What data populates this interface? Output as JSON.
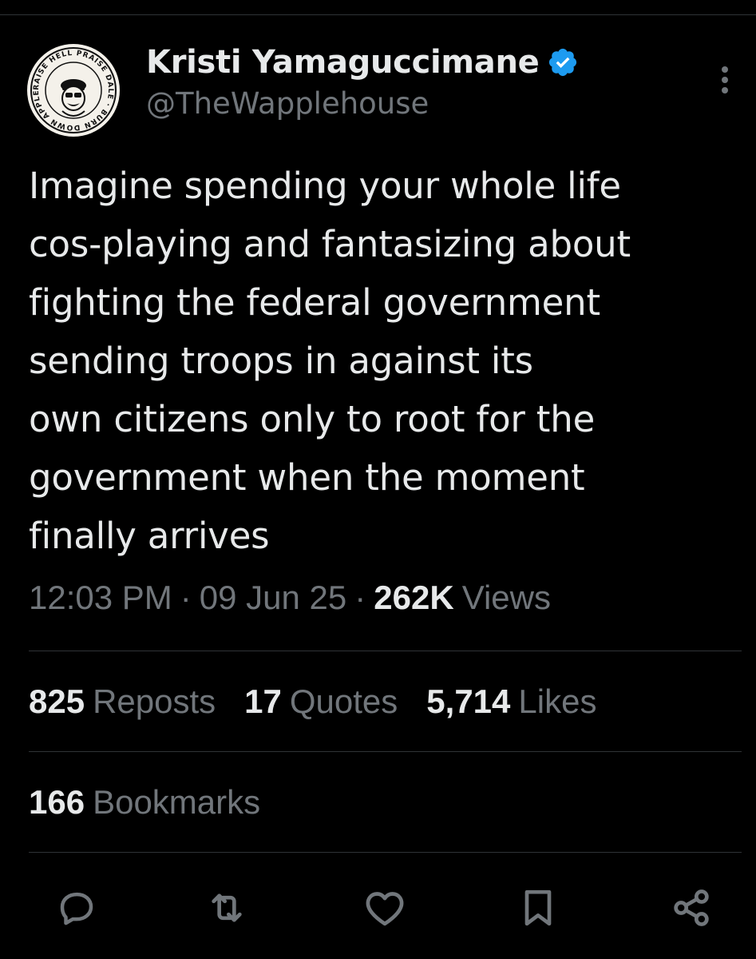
{
  "author": {
    "display_name": "Kristi Yamaguccimane",
    "handle": "@TheWapplehouse",
    "verified": true,
    "avatar_text": "RAISE HELL PRAISE DALE BURN DOWN APPLEBEE'S"
  },
  "tweet": {
    "text": "Imagine spending your whole life\ncos-playing and fantasizing about\nfighting the federal government\nsending troops in against its\nown citizens only to root for the\ngovernment when the moment\nfinally arrives",
    "time": "12:03 PM",
    "date": "09 Jun 25",
    "views_count": "262K",
    "views_label": "Views",
    "separator": "·"
  },
  "stats": {
    "reposts": {
      "count": "825",
      "label": "Reposts"
    },
    "quotes": {
      "count": "17",
      "label": "Quotes"
    },
    "likes": {
      "count": "5,714",
      "label": "Likes"
    },
    "bookmarks": {
      "count": "166",
      "label": "Bookmarks"
    }
  },
  "actions": [
    "reply-icon",
    "repost-icon",
    "like-icon",
    "bookmark-icon",
    "share-icon"
  ],
  "colors": {
    "background": "#000000",
    "text_primary": "#e7e9ea",
    "text_secondary": "#71767b",
    "divider": "#2f3336",
    "verified_badge": "#1d9bf0"
  }
}
